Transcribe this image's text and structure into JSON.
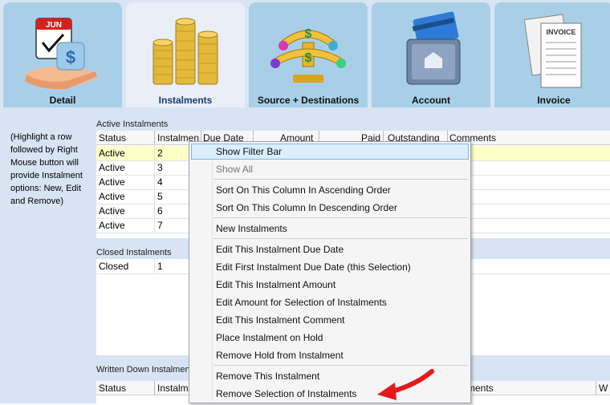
{
  "tabs": [
    {
      "label": "Detail",
      "icon": "calendar-money-hand-icon",
      "active": false
    },
    {
      "label": "Instalments",
      "icon": "coin-stacks-icon",
      "active": true
    },
    {
      "label": "Source + Destinations",
      "icon": "money-tree-icon",
      "active": false
    },
    {
      "label": "Account",
      "icon": "credit-card-safe-icon",
      "active": false
    },
    {
      "label": "Invoice",
      "icon": "invoice-documents-icon",
      "active": false
    }
  ],
  "calendar": {
    "month": "JUN",
    "currency": "$"
  },
  "invoice_icon_text": "INVOICE",
  "help_text": "(Highlight a row followed by Right Mouse button will provide Instalment options: New, Edit and Remove)",
  "active_instalments": {
    "title": "Active Instalments",
    "columns": [
      "Status",
      "Instalmen",
      "Due Date",
      "Amount",
      "Paid",
      "Outstanding",
      "Comments"
    ],
    "rows": [
      {
        "status": "Active",
        "instalment": "2"
      },
      {
        "status": "Active",
        "instalment": "3"
      },
      {
        "status": "Active",
        "instalment": "4"
      },
      {
        "status": "Active",
        "instalment": "5"
      },
      {
        "status": "Active",
        "instalment": "6"
      },
      {
        "status": "Active",
        "instalment": "7"
      }
    ]
  },
  "closed_instalments": {
    "title": "Closed Instalments",
    "rows": [
      {
        "status": "Closed",
        "instalment": "1"
      }
    ]
  },
  "written_down": {
    "title": "Written Down Instalments",
    "columns": [
      "Status",
      "Instalm",
      "ments",
      "W"
    ]
  },
  "context_menu": {
    "items": [
      {
        "label": "Show Filter Bar",
        "enabled": true,
        "highlighted": true
      },
      {
        "label": "Show All",
        "enabled": false
      },
      {
        "label": "Sort On This Column In Ascending Order",
        "enabled": true
      },
      {
        "label": "Sort On This Column In Descending Order",
        "enabled": true
      },
      {
        "label": "New Instalments",
        "enabled": true
      },
      {
        "label": "Edit This Instalment Due Date",
        "enabled": true
      },
      {
        "label": "Edit First Instalment Due Date (this Selection)",
        "enabled": true
      },
      {
        "label": "Edit This Instalment Amount",
        "enabled": true
      },
      {
        "label": "Edit Amount for Selection of Instalments",
        "enabled": true
      },
      {
        "label": "Edit This Instalment Comment",
        "enabled": true
      },
      {
        "label": "Place Instalment on Hold",
        "enabled": true
      },
      {
        "label": "Remove Hold from Instalment",
        "enabled": true
      },
      {
        "label": "Remove This Instalment",
        "enabled": true
      },
      {
        "label": "Remove Selection of Instalments",
        "enabled": true
      }
    ]
  },
  "colors": {
    "accent": "#1a3a78",
    "selected_row": "#ffffc8",
    "arrow": "#e3191c",
    "tab": "#a9cfe8"
  }
}
